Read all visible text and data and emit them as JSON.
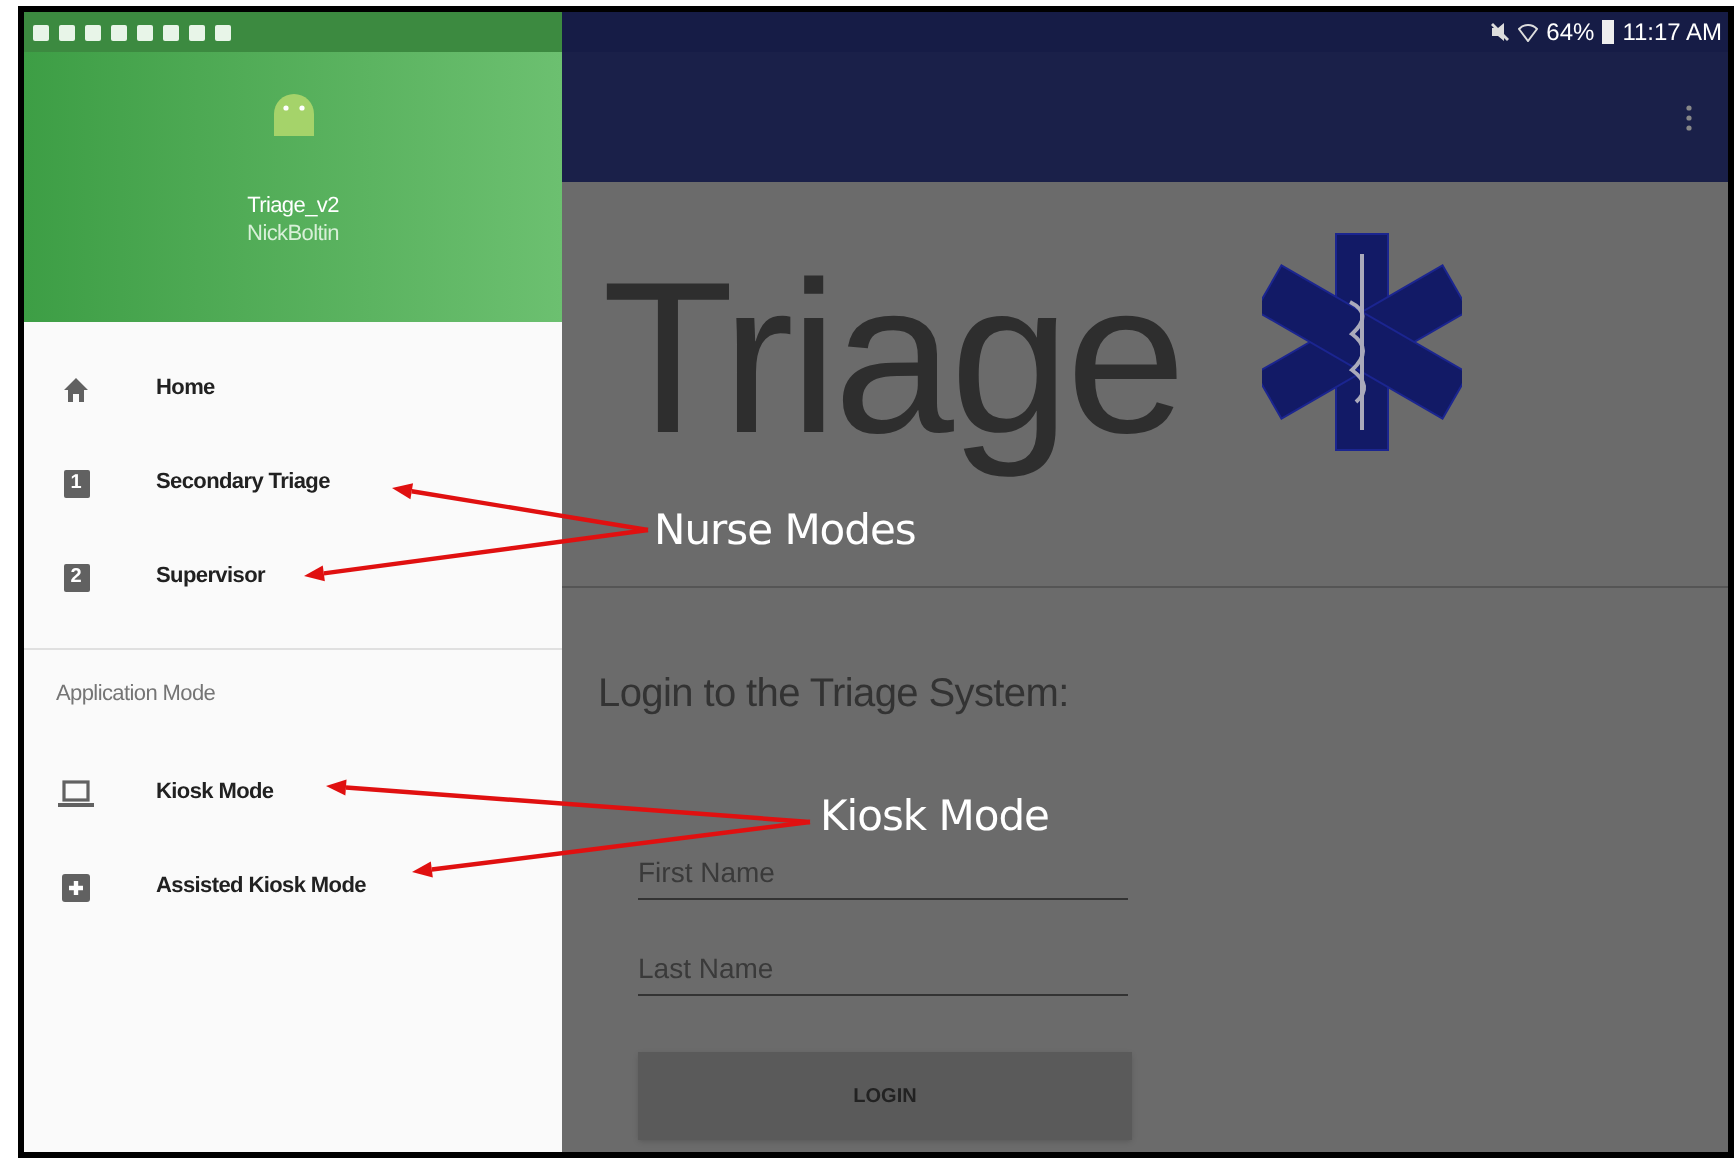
{
  "status_bar": {
    "battery": "64%",
    "time": "11:17 AM"
  },
  "drawer": {
    "app_name": "Triage_v2",
    "user": "NickBoltin",
    "items": [
      {
        "kind": "home",
        "label": "Home"
      },
      {
        "kind": "number",
        "badge": "1",
        "label": "Secondary Triage"
      },
      {
        "kind": "number",
        "badge": "2",
        "label": "Supervisor"
      }
    ],
    "section_title": "Application Mode",
    "mode_items": [
      {
        "kind": "laptop",
        "label": "Kiosk Mode"
      },
      {
        "kind": "plus",
        "label": "Assisted Kiosk Mode"
      }
    ]
  },
  "main": {
    "title": "Triage",
    "login_heading": "Login to the Triage System:",
    "fields": [
      {
        "placeholder": "First Name"
      },
      {
        "placeholder": "Last Name"
      }
    ],
    "button": "LOGIN"
  },
  "annotations": [
    {
      "label": "Nurse Modes"
    },
    {
      "label": "Kiosk Mode"
    }
  ]
}
